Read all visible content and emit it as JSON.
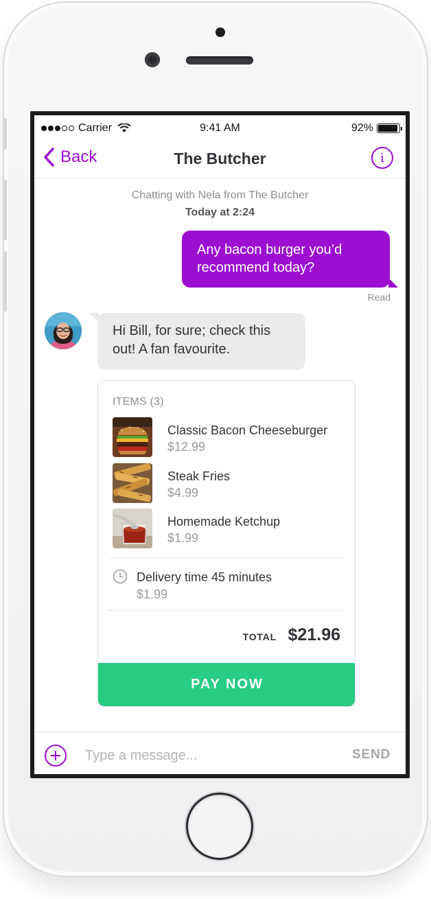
{
  "status_bar": {
    "carrier": "Carrier",
    "time": "9:41 AM",
    "battery": "92%",
    "battery_level": 0.92,
    "signal_bars_filled": 3,
    "signal_bars_total": 5
  },
  "nav": {
    "back_label": "Back",
    "title": "The Butcher",
    "info_icon": "info-icon"
  },
  "chat": {
    "meta": "Chatting with Nela from The Butcher",
    "date": "Today at 2:24",
    "outgoing_message": "Any bacon burger you’d recommend today?",
    "read_receipt": "Read",
    "incoming_message": "Hi Bill, for sure; check this out! A fan favourite."
  },
  "order": {
    "items_heading": "ITEMS (3)",
    "items": [
      {
        "name": "Classic Bacon Cheeseburger",
        "price": "$12.99",
        "image": "burger-image"
      },
      {
        "name": "Steak Fries",
        "price": "$4.99",
        "image": "fries-image"
      },
      {
        "name": "Homemade Ketchup",
        "price": "$1.99",
        "image": "ketchup-image"
      }
    ],
    "delivery_label": "Delivery time 45 minutes",
    "delivery_price": "$1.99",
    "total_label": "TOTAL",
    "total_value": "$21.96",
    "pay_button": "PAY NOW"
  },
  "composer": {
    "placeholder": "Type a message...",
    "send_label": "SEND"
  },
  "colors": {
    "accent": "#9b0fd0",
    "pay": "#28cc84",
    "incoming_bubble": "#ebebed"
  }
}
